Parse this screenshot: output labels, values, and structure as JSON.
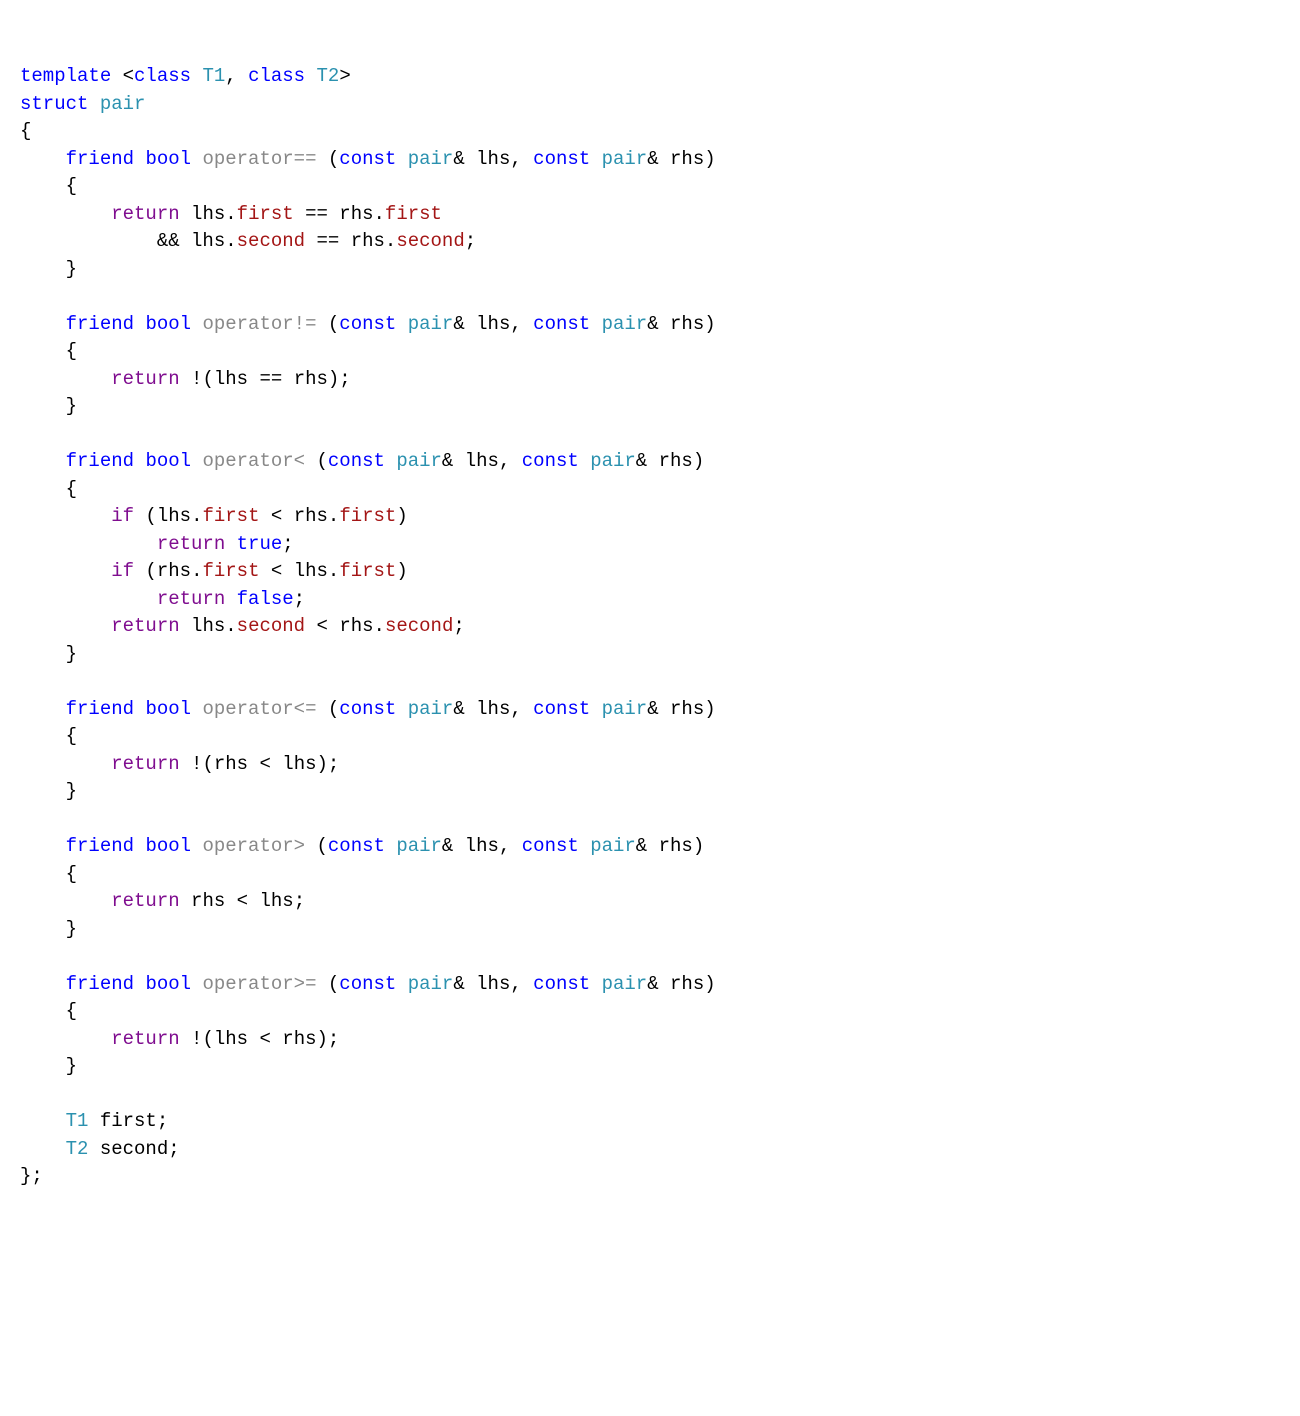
{
  "c": {
    "kw_template": "template",
    "kw_class": "class",
    "kw_struct": "struct",
    "kw_friend": "friend",
    "kw_bool": "bool",
    "kw_const": "const",
    "kw_if": "if",
    "kw_return": "return",
    "kw_true": "true",
    "kw_false": "false",
    "type_T1": "T1",
    "type_T2": "T2",
    "type_pair": "pair",
    "fn_eq": "operator",
    "fn_ne": "operator",
    "fn_lt": "operator",
    "fn_le": "operator",
    "fn_gt": "operator",
    "fn_ge": "operator",
    "sym_eq": "==",
    "sym_ne": "!=",
    "sym_lt": "<",
    "sym_le": "<=",
    "sym_gt": ">",
    "sym_ge": ">=",
    "mem_first": "first",
    "mem_second": "second",
    "id_lhs": "lhs",
    "id_rhs": "rhs"
  }
}
